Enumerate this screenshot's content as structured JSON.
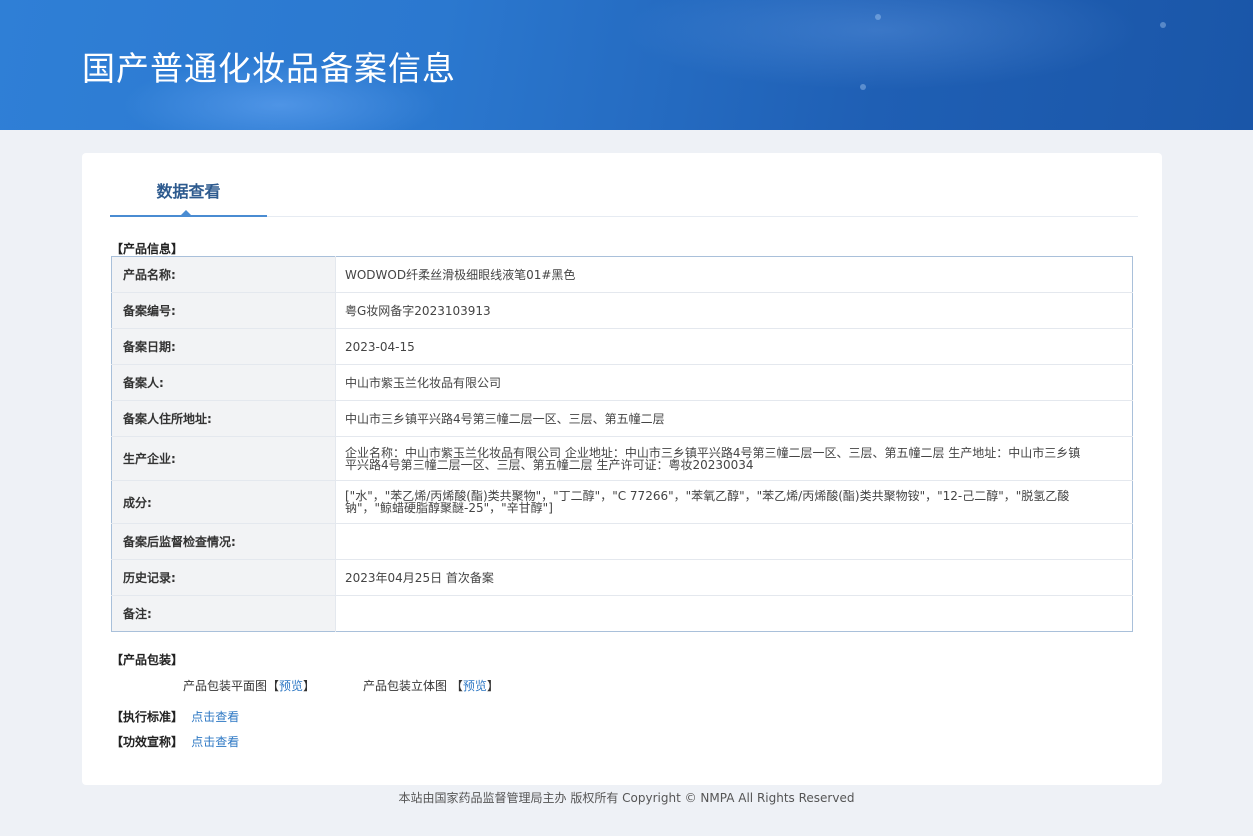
{
  "banner": {
    "title": "国产普通化妆品备案信息"
  },
  "tab": {
    "label": "数据查看"
  },
  "sections": {
    "product_info": "【产品信息】",
    "packaging": "【产品包装】",
    "standard": "【执行标准】",
    "efficacy": "【功效宣称】"
  },
  "product_info": {
    "rows": [
      {
        "label": "产品名称:",
        "value": "WODWOD纤柔丝滑极细眼线液笔01#黑色"
      },
      {
        "label": "备案编号:",
        "value": "粤G妆网备字2023103913"
      },
      {
        "label": "备案日期:",
        "value": "2023-04-15"
      },
      {
        "label": "备案人:",
        "value": "中山市紫玉兰化妆品有限公司"
      },
      {
        "label": "备案人住所地址:",
        "value": "中山市三乡镇平兴路4号第三幢二层一区、三层、第五幢二层"
      },
      {
        "label": "生产企业:",
        "value": "企业名称：中山市紫玉兰化妆品有限公司 企业地址：中山市三乡镇平兴路4号第三幢二层一区、三层、第五幢二层 生产地址：中山市三乡镇平兴路4号第三幢二层一区、三层、第五幢二层 生产许可证：粤妆20230034"
      },
      {
        "label": "成分:",
        "value": "[\"水\"，\"苯乙烯/丙烯酸(酯)类共聚物\"，\"丁二醇\"，\"C 77266\"，\"苯氧乙醇\"，\"苯乙烯/丙烯酸(酯)类共聚物铵\"，\"12-己二醇\"，\"脱氢乙酸钠\"，\"鲸蜡硬脂醇聚醚-25\"，\"辛甘醇\"]"
      },
      {
        "label": "备案后监督检查情况:",
        "value": ""
      },
      {
        "label": "历史记录:",
        "value": "2023年04月25日 首次备案"
      },
      {
        "label": "备注:",
        "value": ""
      }
    ]
  },
  "packaging": {
    "flat_label": "产品包装平面图",
    "flat_preview": "预览",
    "solid_label": "产品包装立体图",
    "solid_preview": "预览",
    "bracket_open": "【",
    "bracket_close": "】"
  },
  "links": {
    "standard_view": "点击查看",
    "efficacy_view": "点击查看"
  },
  "footer": {
    "text": "本站由国家药品监督管理局主办 版权所有 Copyright © NMPA All Rights Reserved"
  }
}
